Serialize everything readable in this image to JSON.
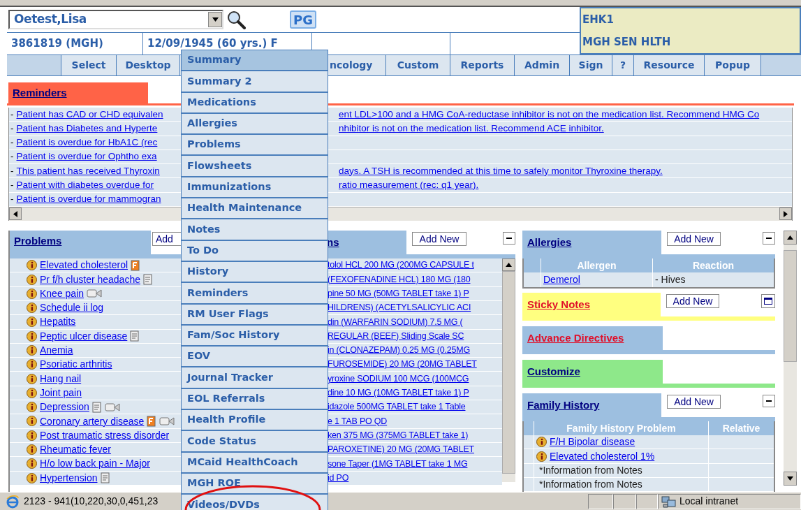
{
  "patient": {
    "name": "Oetest,Lisa",
    "mrn": "3861819 (MGH)",
    "dob": "12/09/1945 (60 yrs.) F",
    "badge": "PG"
  },
  "location": {
    "code": "EHK1",
    "unit": "MGH SEN HLTH"
  },
  "nav": [
    {
      "label": "Select"
    },
    {
      "label": "Desktop"
    },
    {
      "label": "ncology"
    },
    {
      "label": "Custom"
    },
    {
      "label": "Reports"
    },
    {
      "label": "Admin"
    },
    {
      "label": "Sign"
    },
    {
      "label": "?"
    },
    {
      "label": "Resource"
    },
    {
      "label": "Popup"
    }
  ],
  "menu": [
    {
      "label": "Summary",
      "selected": true
    },
    {
      "label": "Summary 2",
      "selected": false
    },
    {
      "label": "Medications",
      "selected": false
    },
    {
      "label": "Allergies",
      "selected": false
    },
    {
      "label": "Problems",
      "selected": false
    },
    {
      "label": "Flowsheets",
      "selected": false
    },
    {
      "label": "Immunizations",
      "selected": false
    },
    {
      "label": "Health Maintenance",
      "selected": false
    },
    {
      "label": "Notes",
      "selected": false
    },
    {
      "label": "To Do",
      "selected": false
    },
    {
      "label": "History",
      "selected": false
    },
    {
      "label": "Reminders",
      "selected": false
    },
    {
      "label": "RM User Flags",
      "selected": false
    },
    {
      "label": "Fam/Soc History",
      "selected": false
    },
    {
      "label": "EOV",
      "selected": false
    },
    {
      "label": "Journal Tracker",
      "selected": false
    },
    {
      "label": "EOL Referrals",
      "selected": false
    },
    {
      "label": "Health Profile",
      "selected": false
    },
    {
      "label": "Code Status",
      "selected": false
    },
    {
      "label": "MCaid HealthCoach",
      "selected": false
    },
    {
      "label": "MGH ROE",
      "selected": false
    },
    {
      "label": "Videos/DVDs",
      "selected": false
    }
  ],
  "reminders": {
    "title": "Reminders",
    "items": [
      {
        "dash": "-",
        "left": "Patient has CAD or CHD equivalen",
        "right": "ent LDL>100 and a HMG CoA-reductase inhibitor is not on the medication list. Recommend HMG Co"
      },
      {
        "dash": "-",
        "left": "Patient has Diabetes and Hyperte",
        "right": "nhibitor is not on the medication list. Recommend ACE inhibitor."
      },
      {
        "dash": "-",
        "left": "Patient is overdue for HbA1C (rec"
      },
      {
        "dash": "-",
        "left": "Patient is overdue for Ophtho exa"
      },
      {
        "dash": "-",
        "left": "This patient has received Thyroxin",
        "right": "days. A TSH is recommended at this time to safely monitor Thyroxine therapy."
      },
      {
        "dash": "-",
        "left": "Patient with diabetes overdue for",
        "right": "ratio measurement (rec: q1 year)."
      },
      {
        "dash": "-",
        "left": "Patient is overdue for mammogran"
      }
    ]
  },
  "problems": {
    "title": "Problems",
    "add_button": "Add",
    "items": [
      {
        "label": "Elevated cholesterol",
        "flagged": true
      },
      {
        "label": "Pr f/h cluster headache",
        "has_note": true
      },
      {
        "label": "Knee pain",
        "has_video": true
      },
      {
        "label": "Schedule ii log"
      },
      {
        "label": "Hepatits"
      },
      {
        "label": "Peptic ulcer disease",
        "has_note": true
      },
      {
        "label": "Anemia"
      },
      {
        "label": "Psoriatic arthritis"
      },
      {
        "label": "Hang nail"
      },
      {
        "label": "Joint pain"
      },
      {
        "label": "Depression",
        "has_note": true,
        "has_video": true
      },
      {
        "label": "Coronary artery disease",
        "flagged": true,
        "has_video": true
      },
      {
        "label": "Post traumatic stress disorder"
      },
      {
        "label": "Rheumatic fever"
      },
      {
        "label": "H/o low back pain - Major"
      },
      {
        "label": "Hypertension",
        "has_note": true
      }
    ]
  },
  "medications": {
    "title": "ns",
    "add_button": "Add New",
    "items": [
      "tolol HCL 200 MG (200MG CAPSULE t",
      "(FEXOFENADINE HCL) 180 MG (180",
      "pine 50 MG (50MG TABLET take 1) P",
      "HILDRENS) (ACETYLSALICYLIC ACI",
      "din (WARFARIN SODIUM) 7.5 MG (",
      "REGULAR (BEEF) Sliding Scale SC",
      "in (CLONAZEPAM) 0.25 MG (0.25MG",
      "FUROSEMIDE) 20 MG (20MG TABLET",
      "yroxine SODIUM 100 MCG (100MCG",
      "dine 10 MG (10MG TABLET take 1) P",
      "idazole 500MG TABLET take 1 Table",
      "e 1 TAB PO QD",
      "ken 375 MG (375MG TABLET take 1)",
      "PAROXETINE) 20 MG (20MG TABLET",
      "sone Taper (1MG TABLET take 1 MG",
      "id PO"
    ]
  },
  "allergies": {
    "title": "Allergies",
    "add_button": "Add New",
    "columns": [
      "Allergen",
      "Reaction"
    ],
    "rows": [
      {
        "allergen": "Demerol",
        "reaction": "- Hives"
      }
    ]
  },
  "sticky_notes": {
    "title": "Sticky Notes",
    "add_button": "Add New"
  },
  "advance_directives": {
    "title": "Advance Directives"
  },
  "customize": {
    "title": "Customize"
  },
  "family_history": {
    "title": "Family History",
    "add_button": "Add New",
    "columns": [
      "Family History Problem",
      "Relative"
    ],
    "rows": [
      {
        "kind": "link",
        "problem": "F/H Bipolar disease"
      },
      {
        "kind": "link",
        "problem": "Elevated cholesterol 1%"
      },
      {
        "kind": "text",
        "problem": "*Information from Notes"
      },
      {
        "kind": "text",
        "problem": "*Information from Notes"
      }
    ]
  },
  "status_bar": {
    "text": "2123 - 941(10,220,30,0,451,23",
    "zone": "Local intranet"
  }
}
